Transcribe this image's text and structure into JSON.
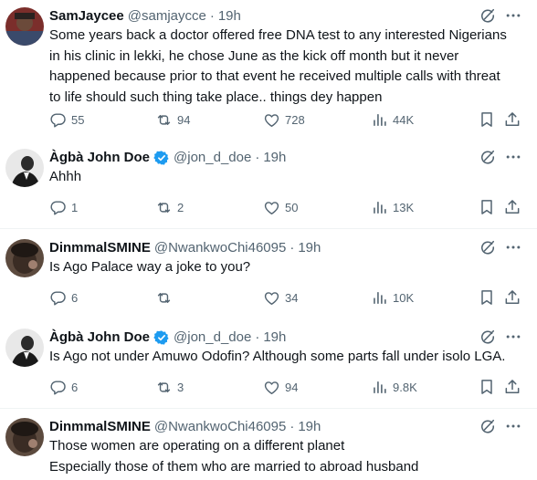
{
  "tweets": [
    {
      "name": "SamJaycee",
      "handle": "@samjaycce",
      "time": "19h",
      "verified": false,
      "lines": [
        "Some years back a doctor offered free DNA test to any interested Nigerians",
        "in his clinic in lekki, he chose June as the kick off month but it never",
        "happened because prior to that event he received multiple calls with threat",
        "to life should such thing take place.. things dey happen"
      ],
      "replies": "55",
      "reposts": "94",
      "likes": "728",
      "views": "44K"
    },
    {
      "name": "Àgbà John Doe",
      "handle": "@jon_d_doe",
      "time": "19h",
      "verified": true,
      "lines": [
        "Ahhh"
      ],
      "replies": "1",
      "reposts": "2",
      "likes": "50",
      "views": "13K"
    },
    {
      "name": "DinmmalSMINE",
      "handle": "@NwankwoChi46095",
      "time": "19h",
      "verified": false,
      "lines": [
        "Is Ago Palace way a joke to you?"
      ],
      "replies": "6",
      "reposts": "",
      "likes": "34",
      "views": "10K"
    },
    {
      "name": "Àgbà John Doe",
      "handle": "@jon_d_doe",
      "time": "19h",
      "verified": true,
      "lines": [
        "Is Ago not under Amuwo Odofin? Although some parts fall under isolo LGA."
      ],
      "replies": "6",
      "reposts": "3",
      "likes": "94",
      "views": "9.8K"
    },
    {
      "name": "DinmmalSMINE",
      "handle": "@NwankwoChi46095",
      "time": "19h",
      "verified": false,
      "lines": [
        "Those women are operating on a different planet",
        "Especially those of them who are married to abroad husband"
      ]
    }
  ],
  "separator": "·",
  "colors": {
    "text": "#0f1419",
    "secondary": "#536471",
    "verified": "#1d9bf0",
    "divider": "#eff3f4"
  },
  "icons": {
    "reply": "reply-icon",
    "repost": "repost-icon",
    "like": "like-icon",
    "views": "views-icon",
    "bookmark": "bookmark-icon",
    "share": "share-icon",
    "grok": "grok-icon",
    "more": "more-icon",
    "verified": "verified-badge-icon"
  }
}
